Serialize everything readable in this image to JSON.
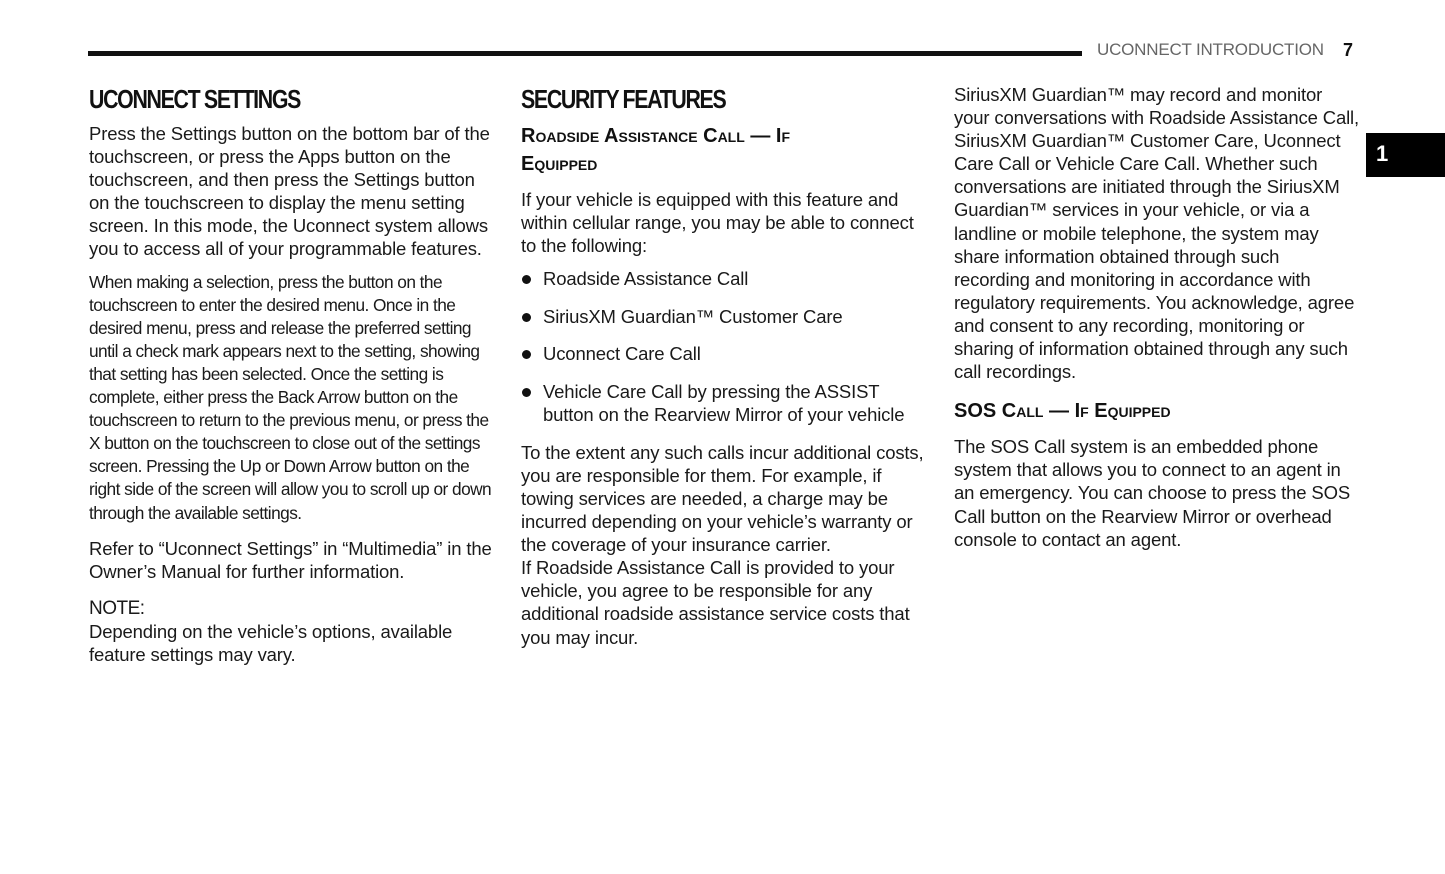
{
  "header": {
    "running_head": "UCONNECT INTRODUCTION",
    "page_number": "7",
    "chapter_tab": "1"
  },
  "column1": {
    "title": "UCONNECT SETTINGS",
    "para1": "Press the Settings button on the bottom bar of the touchscreen, or press the Apps button on the touchscreen, and then press the Settings button on the touchscreen to display the menu setting screen. In this mode, the Uconnect system allows you to access all of your programmable features.",
    "para2": "When making a selection, press the button on the touchscreen to enter the desired menu. Once in the desired menu, press and release the preferred setting until a check mark appears next to the setting, showing that setting has been selected. Once the setting is complete, either press the Back Arrow button on the touchscreen to return to the previous menu, or press the X button on the touchscreen to close out of the settings screen. Pressing the Up or Down Arrow button on the right side of the screen will allow you to scroll up or down through the available settings.",
    "para3": "Refer to “Uconnect Settings” in “Multimedia” in the Owner’s Manual for further information.",
    "note_label": "NOTE:",
    "note_text": "Depending on the vehicle’s options, available feature settings may vary."
  },
  "column2": {
    "title": "SECURITY FEATURES",
    "subtitle": "Roadside Assistance Call — If Equipped",
    "intro": "If your vehicle is equipped with this feature and within cellular range, you may be able to connect to the following:",
    "bullets": [
      "Roadside Assistance Call",
      "SiriusXM Guardian™ Customer Care",
      "Uconnect Care Call",
      "Vehicle Care Call by pressing the ASSIST button on the Rearview Mirror of your vehicle"
    ],
    "para_costs": "To the extent any such calls incur additional costs, you are responsible for them. For example, if towing services are needed, a charge may be incurred depending on your vehicle’s warranty or the coverage of your insurance carrier.",
    "para_roadside": "If Roadside Assistance Call is provided to your vehicle, you agree to be responsible for any additional roadside assistance service costs that you may incur."
  },
  "column3": {
    "para_recording": "SiriusXM Guardian™ may record and monitor your conversations with Roadside Assistance Call, SiriusXM Guardian™ Customer Care, Uconnect Care Call or Vehicle Care Call. Whether such conversations are initiated through the SiriusXM Guardian™ services in your vehicle, or via a landline or mobile telephone, the system may share information obtained through such recording and monitoring in accordance with regulatory requirements. You acknowledge, agree and consent to any recording, monitoring or sharing of information obtained through any such call recordings.",
    "sos_title": "SOS Call — If Equipped",
    "sos_text": "The SOS Call system is an embedded phone system that allows you to connect to an agent in an emergency. You can choose to press the SOS Call button on the Rearview Mirror or overhead console to contact an agent."
  }
}
